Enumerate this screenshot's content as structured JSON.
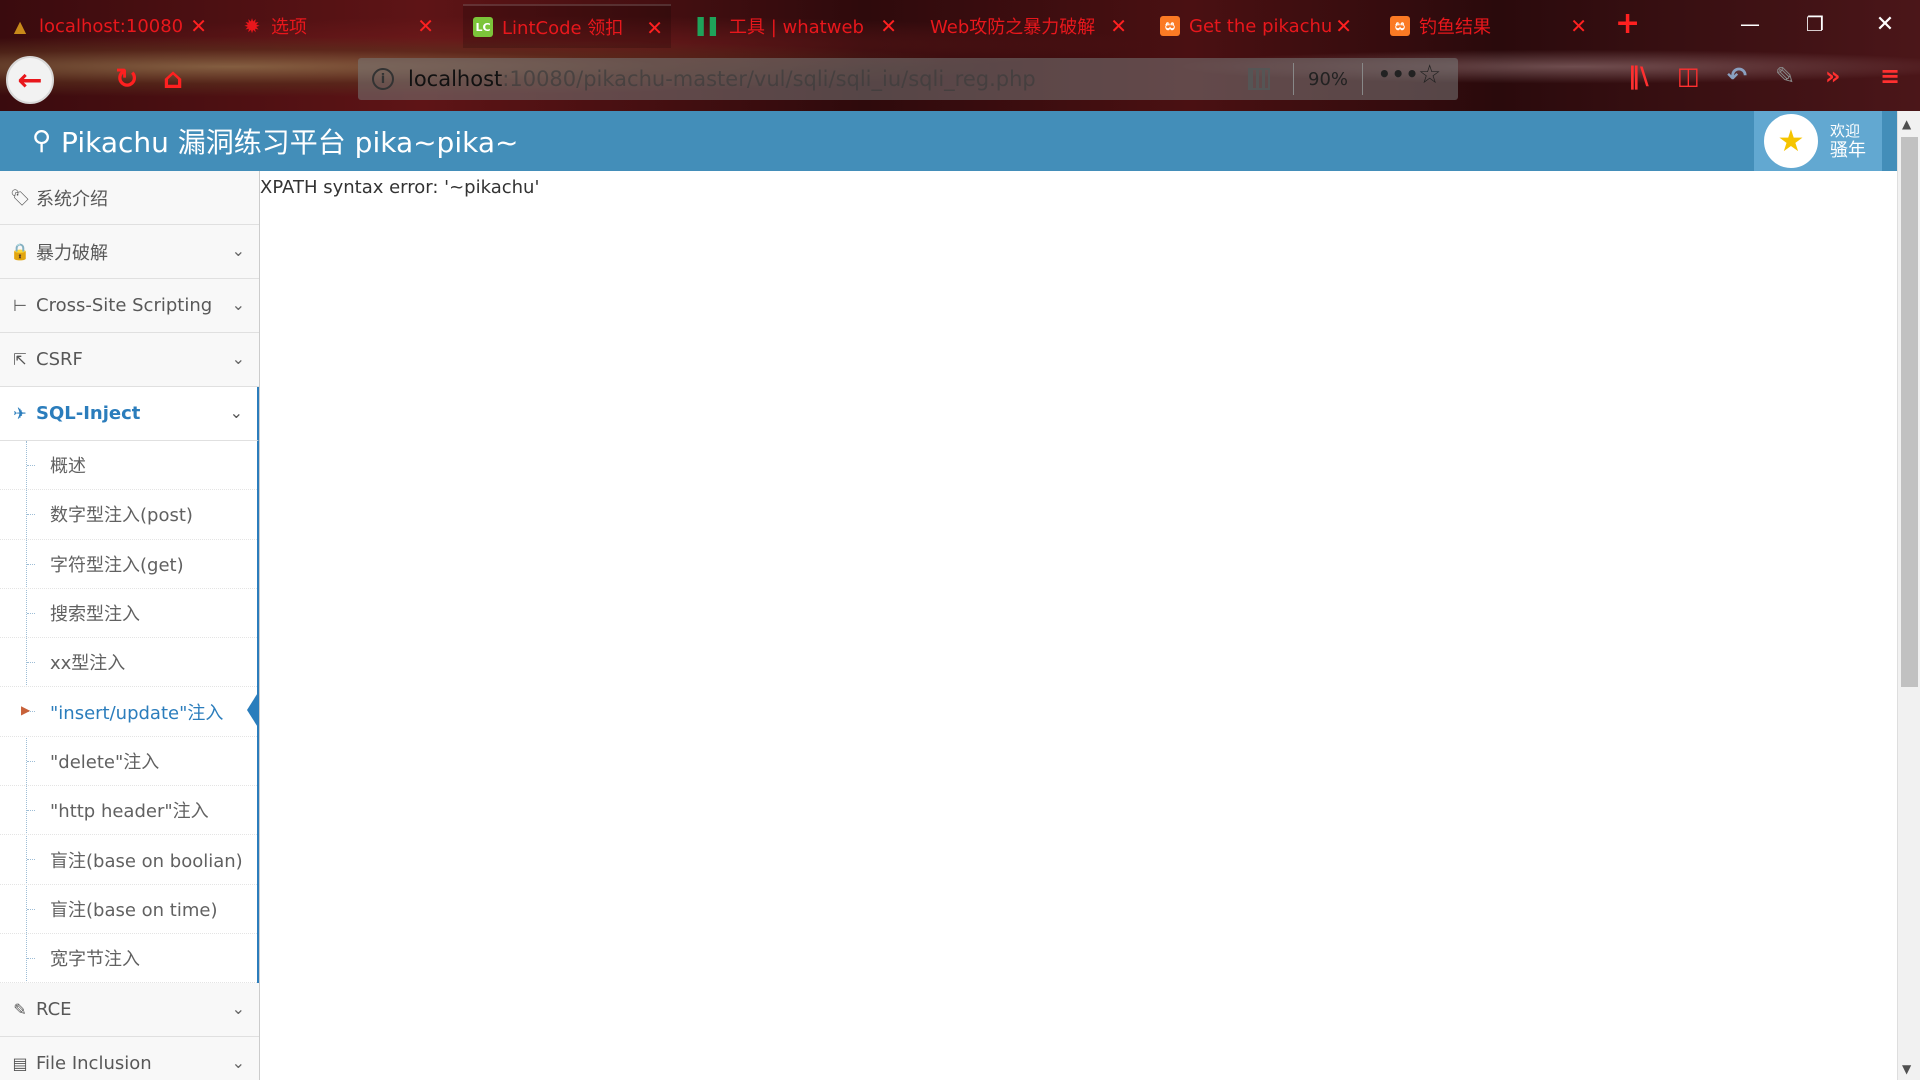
{
  "browser": {
    "tabs": [
      {
        "title": "localhost:10080",
        "favicon": "pikachu-logo-icon",
        "fav_text": "",
        "fav_color": "#c98a1a"
      },
      {
        "title": "选项",
        "favicon": "gear-icon",
        "fav_text": "✹",
        "fav_color": "#e8171c"
      },
      {
        "title": "LintCode 领扣",
        "favicon": "lintcode-icon",
        "fav_text": "LC",
        "fav_color": "#7cc43a"
      },
      {
        "title": "工具 | whatweb",
        "favicon": "bars-icon",
        "fav_text": "▌▌",
        "fav_color": "#1fa35a"
      },
      {
        "title": "Web攻防之暴力破解",
        "favicon": "",
        "fav_text": "",
        "fav_color": ""
      },
      {
        "title": "Get the pikachu",
        "favicon": "xampp-icon",
        "fav_text": "ස",
        "fav_color": "#fb7a24"
      },
      {
        "title": "钓鱼结果",
        "favicon": "xampp-icon",
        "fav_text": "ස",
        "fav_color": "#fb7a24"
      }
    ],
    "url_host": "localhost",
    "url_path": ":10080/pikachu-master/vul/sqli/sqli_iu/sqli_reg.php",
    "zoom": "90%",
    "more": "•••"
  },
  "header": {
    "title": "Pikachu 漏洞练习平台 pika~pika~",
    "welcome": "欢迎",
    "username": "骚年"
  },
  "sidebar": {
    "items": [
      {
        "label": "系统介绍",
        "icon": "tags-icon"
      },
      {
        "label": "暴力破解",
        "icon": "lock-icon"
      },
      {
        "label": "Cross-Site Scripting",
        "icon": "list-icon"
      },
      {
        "label": "CSRF",
        "icon": "share-icon"
      },
      {
        "label": "SQL-Inject",
        "icon": "fighter-jet-icon"
      },
      {
        "label": "RCE",
        "icon": "pencil-icon"
      },
      {
        "label": "File Inclusion",
        "icon": "file-icon"
      }
    ],
    "sql_sub": [
      "概述",
      "数字型注入(post)",
      "字符型注入(get)",
      "搜索型注入",
      "xx型注入",
      "\"insert/update\"注入",
      "\"delete\"注入",
      "\"http header\"注入",
      "盲注(base on boolian)",
      "盲注(base on time)",
      "宽字节注入"
    ]
  },
  "main": {
    "error": "XPATH syntax error: '~pikachu'"
  },
  "colors": {
    "header_bg": "#438eb9",
    "accent": "#2b7dbc",
    "tab_text": "#e8171c"
  }
}
